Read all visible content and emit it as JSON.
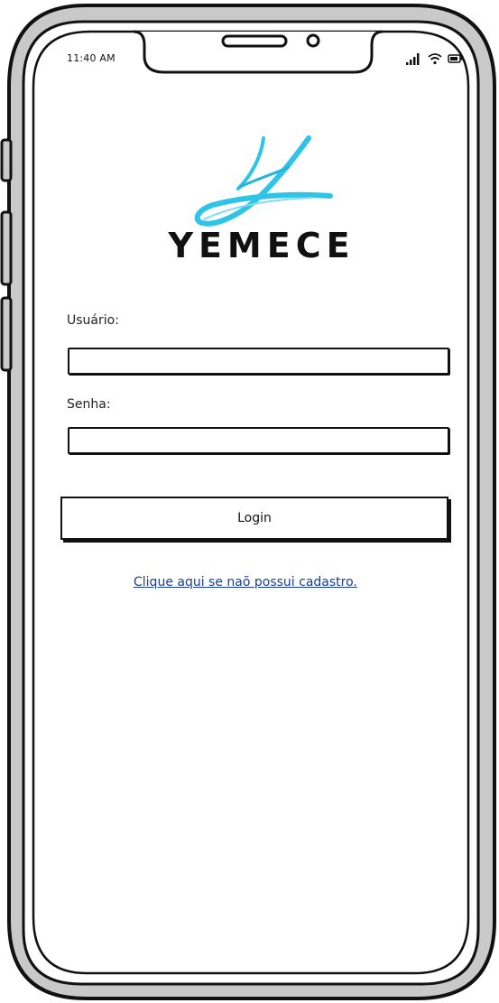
{
  "status_bar": {
    "time": "11:40 AM",
    "icons": [
      "signal-icon",
      "wifi-icon",
      "battery-icon"
    ]
  },
  "brand": {
    "name": "YEMECE",
    "logo": "y-script-logo",
    "logo_color": "#2ec4e8"
  },
  "form": {
    "username_label": "Usuário:",
    "username_value": "",
    "password_label": "Senha:",
    "password_value": "",
    "login_label": "Login"
  },
  "signup": {
    "link_text": "Clique aqui se naõ possui cadastro."
  }
}
